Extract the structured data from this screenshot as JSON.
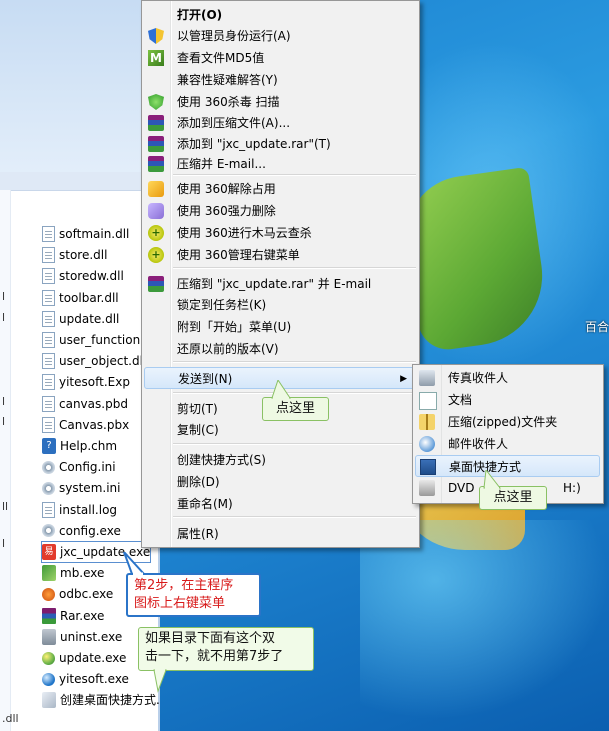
{
  "explorer": {
    "files": [
      "softmain.dll",
      "store.dll",
      "storedw.dll",
      "toolbar.dll",
      "update.dll",
      "user_function...",
      "user_object.dll",
      "yitesoft.Exp",
      "canvas.pbd",
      "Canvas.pbx",
      "Help.chm",
      "Config.ini",
      "system.ini",
      "install.log",
      "config.exe",
      "jxc_update.exe",
      "mb.exe",
      "odbc.exe",
      "Rar.exe",
      "uninst.exe",
      "update.exe",
      "yitesoft.exe",
      "创建桌面快捷方式.exe"
    ],
    "file_icons": [
      "doc",
      "doc",
      "doc",
      "doc",
      "doc",
      "doc",
      "doc",
      "doc",
      "doc",
      "doc",
      "help",
      "gear",
      "gear",
      "doc",
      "gear",
      "exe-red",
      "mb",
      "db",
      "rar",
      "uninst",
      "globe2",
      "blue-e",
      "shortcut"
    ],
    "left_labels": [
      "l",
      "l",
      "l",
      "l",
      "ll",
      "l",
      "dll"
    ],
    "bottom_label": ".dll"
  },
  "desktop": {
    "right_label": "百合"
  },
  "context_menu": {
    "items": [
      {
        "label": "打开(O)",
        "icon": "",
        "bold": true
      },
      {
        "label": "以管理员身份运行(A)",
        "icon": "shield"
      },
      {
        "label": "查看文件MD5值",
        "icon": "md5",
        "glyph": "M"
      },
      {
        "label": "兼容性疑难解答(Y)",
        "icon": ""
      },
      {
        "label": "使用 360杀毒 扫描",
        "icon": "s360"
      },
      {
        "label": "添加到压缩文件(A)...",
        "icon": "rarbooks"
      },
      {
        "label": "添加到 \"jxc_update.rar\"(T)",
        "icon": "rarbooks"
      },
      {
        "label": "压缩并 E-mail...",
        "icon": "rarbooks"
      },
      {
        "label": "使用 360解除占用",
        "icon": "unlock"
      },
      {
        "label": "使用 360强力删除",
        "icon": "eraser"
      },
      {
        "label": "使用 360进行木马云查杀",
        "icon": "trojan",
        "glyph": "+"
      },
      {
        "label": "使用 360管理右键菜单",
        "icon": "trojan",
        "glyph": "+"
      },
      {
        "label": "压缩到 \"jxc_update.rar\" 并 E-mail",
        "icon": "rarbooks"
      },
      {
        "label": "锁定到任务栏(K)",
        "icon": ""
      },
      {
        "label": "附到「开始」菜单(U)",
        "icon": ""
      },
      {
        "label": "还原以前的版本(V)",
        "icon": ""
      },
      {
        "label": "发送到(N)",
        "icon": "",
        "submenu": true
      },
      {
        "label": "剪切(T)",
        "icon": ""
      },
      {
        "label": "复制(C)",
        "icon": ""
      },
      {
        "label": "创建快捷方式(S)",
        "icon": ""
      },
      {
        "label": "删除(D)",
        "icon": ""
      },
      {
        "label": "重命名(M)",
        "icon": ""
      },
      {
        "label": "属性(R)",
        "icon": ""
      }
    ],
    "submenu_arrow": "▶"
  },
  "send_to_menu": {
    "items": [
      {
        "label": "传真收件人",
        "icon": "fax"
      },
      {
        "label": "文档",
        "icon": "docs"
      },
      {
        "label": "压缩(zipped)文件夹",
        "icon": "zip"
      },
      {
        "label": "邮件收件人",
        "icon": "mail"
      },
      {
        "label": "桌面快捷方式",
        "icon": "desk"
      },
      {
        "label": "DVD",
        "icon": "dvd"
      }
    ],
    "dvd_tail": "H:)"
  },
  "callouts": {
    "click_here_1": "点这里",
    "click_here_2": "点这里",
    "step2_line1": "第2步，在主程序",
    "step2_line2": "图标上右键菜单",
    "tip_line1": "如果目录下面有这个双",
    "tip_line2": "击一下，就不用第7步了"
  },
  "colors": {
    "menu_bg": "#f1f1f1",
    "highlight_border": "#a9ccf1",
    "callout_red_text": "#d81b1b",
    "callout_blue_border": "#2b74c8",
    "callout_green_border": "#8ac164"
  }
}
